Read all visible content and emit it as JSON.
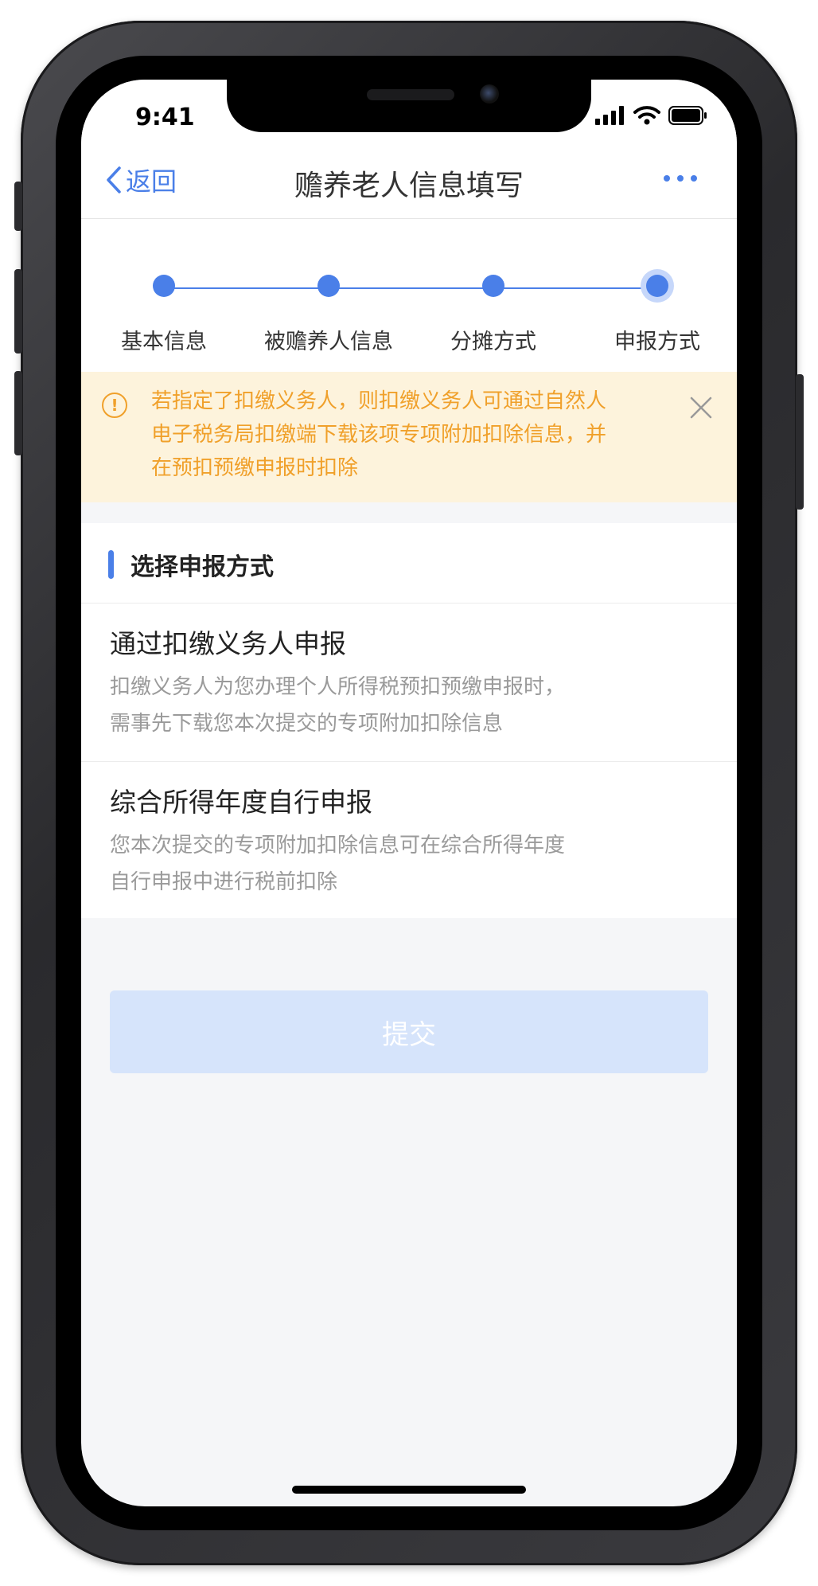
{
  "status_bar": {
    "time": "9:41"
  },
  "nav": {
    "back_label": "返回",
    "title": "赡养老人信息填写"
  },
  "steps": [
    {
      "label": "基本信息"
    },
    {
      "label": "被赡养人信息"
    },
    {
      "label": "分摊方式"
    },
    {
      "label": "申报方式"
    }
  ],
  "notice": {
    "icon_text": "!",
    "lines": [
      "若指定了扣缴义务人，则扣缴义务人可通过自然人",
      "电子税务局扣缴端下载该项专项附加扣除信息，并",
      "在预扣预缴申报时扣除"
    ]
  },
  "section": {
    "title": "选择申报方式",
    "options": [
      {
        "title": "通过扣缴义务人申报",
        "desc_lines": [
          "扣缴义务人为您办理个人所得税预扣预缴申报时，",
          "需事先下载您本次提交的专项附加扣除信息"
        ]
      },
      {
        "title": "综合所得年度自行申报",
        "desc_lines": [
          "您本次提交的专项附加扣除信息可在综合所得年度",
          "自行申报中进行税前扣除"
        ]
      }
    ]
  },
  "submit_label": "提交",
  "colors": {
    "accent": "#4a7fe8",
    "notice_bg": "#fdf3dc",
    "notice_text": "#f0a02a",
    "submit_disabled_bg": "#d6e4fb"
  }
}
